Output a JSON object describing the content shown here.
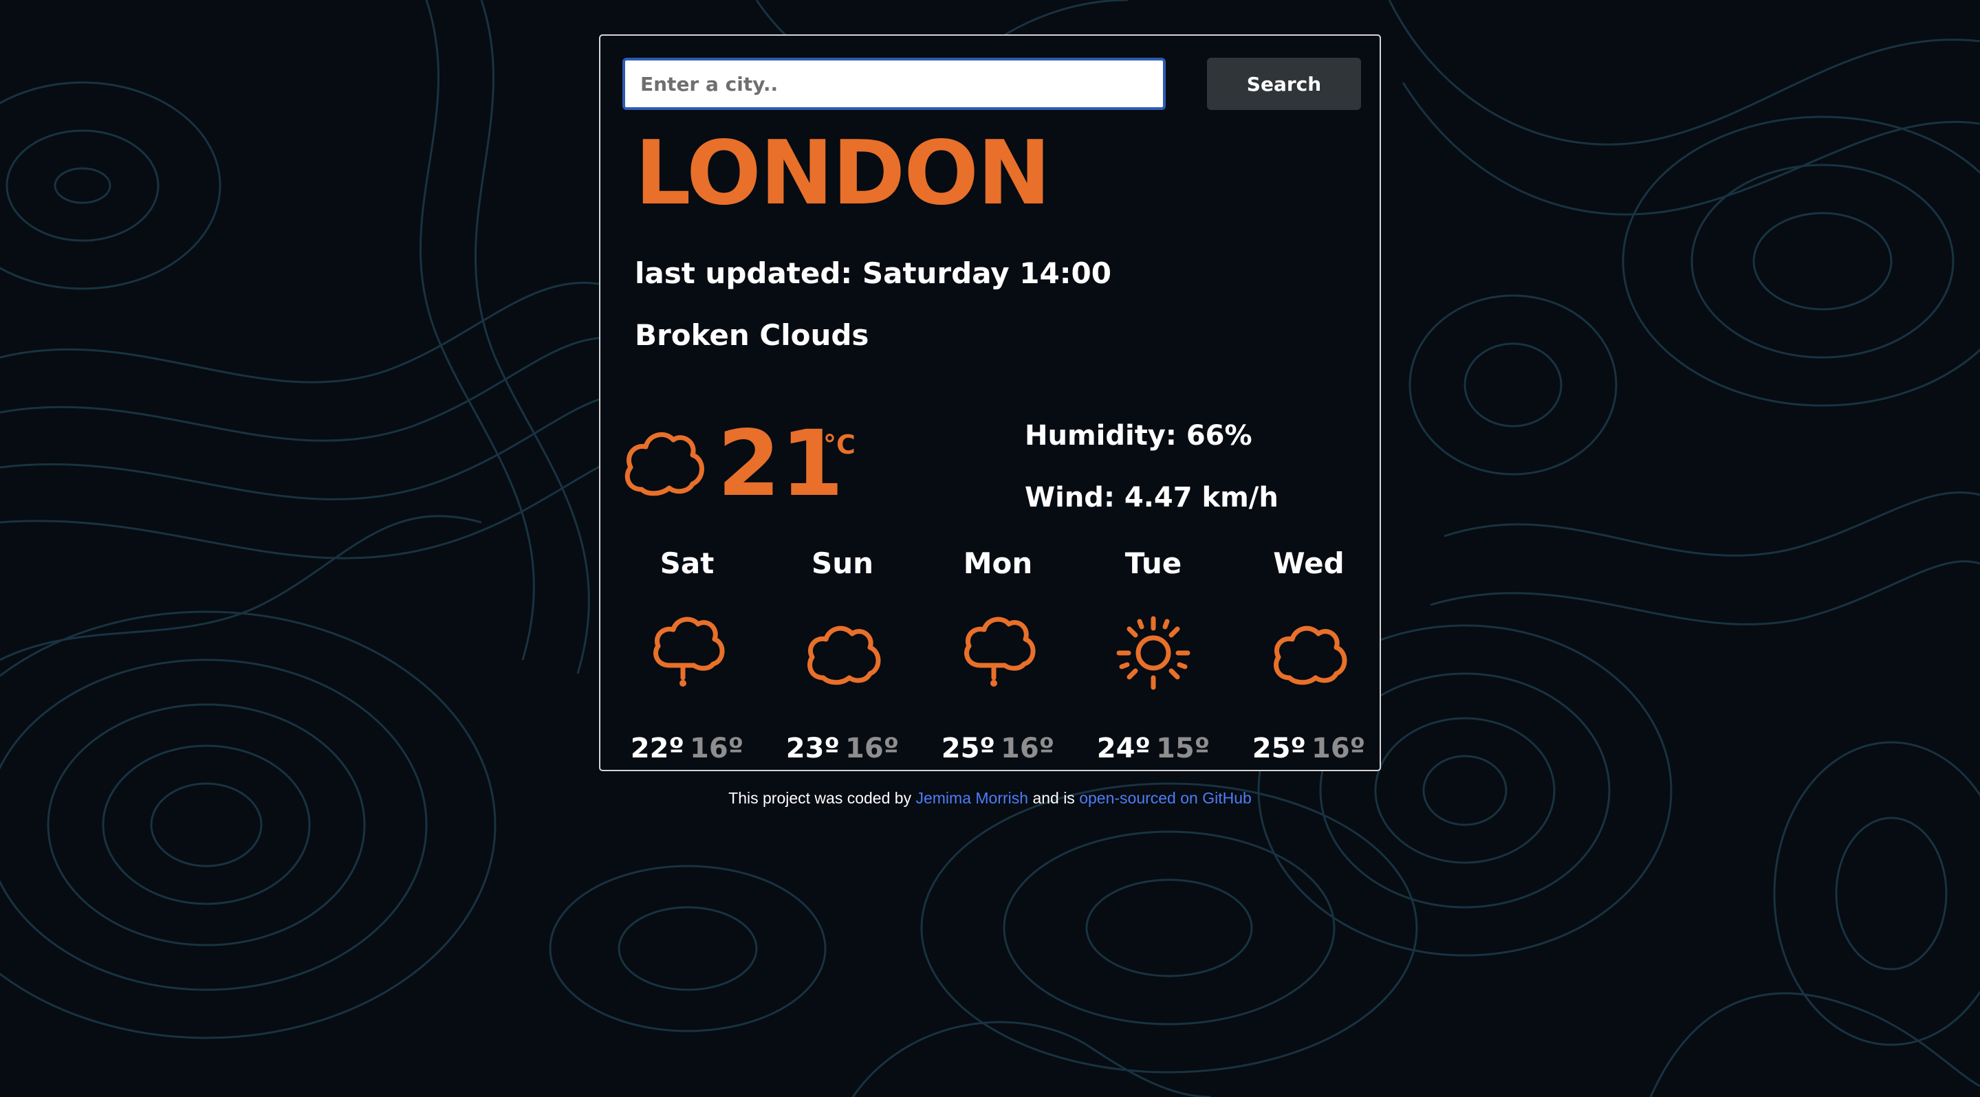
{
  "search": {
    "placeholder": "Enter a city..",
    "button_label": "Search"
  },
  "current": {
    "city": "LONDON",
    "updated_label": "last updated:",
    "updated_day": "Saturday",
    "updated_time": "14:00",
    "description": "Broken Clouds",
    "icon": "cloud-icon",
    "temperature": "21",
    "unit": "°C",
    "humidity_label": "Humidity:",
    "humidity_value": "66%",
    "wind_label": "Wind:",
    "wind_value": "4.47",
    "wind_unit": "km/h"
  },
  "forecast": [
    {
      "day": "Sat",
      "icon": "rain-cloud-icon",
      "max": "22º",
      "min": "16º"
    },
    {
      "day": "Sun",
      "icon": "cloud-icon",
      "max": "23º",
      "min": "16º"
    },
    {
      "day": "Mon",
      "icon": "rain-cloud-icon",
      "max": "25º",
      "min": "16º"
    },
    {
      "day": "Tue",
      "icon": "sun-icon",
      "max": "24º",
      "min": "15º"
    },
    {
      "day": "Wed",
      "icon": "cloud-icon",
      "max": "25º",
      "min": "16º"
    }
  ],
  "footer": {
    "prefix": "This project was coded by",
    "author_link": "Jemima Morrish",
    "middle": "and is",
    "repo_link": "open-sourced on GitHub"
  },
  "colors": {
    "background": "#070b12",
    "accent": "#e8702a",
    "contour": "#1b3a4a",
    "link": "#4d7ef7"
  }
}
